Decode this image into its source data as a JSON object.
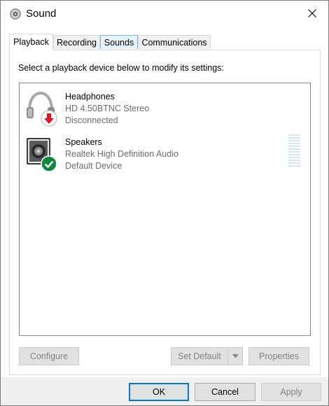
{
  "window": {
    "title": "Sound",
    "close_label": "Close"
  },
  "tabs": [
    {
      "label": "Playback",
      "active": true
    },
    {
      "label": "Recording",
      "active": false
    },
    {
      "label": "Sounds",
      "active": false
    },
    {
      "label": "Communications",
      "active": false
    }
  ],
  "panel": {
    "instruction": "Select a playback device below to modify its settings:",
    "devices": [
      {
        "name": "Headphones",
        "description": "HD 4.50BTNC Stereo",
        "status": "Disconnected",
        "icon": "headphones-icon",
        "badge": "disconnected-arrow-badge"
      },
      {
        "name": "Speakers",
        "description": "Realtek High Definition Audio",
        "status": "Default Device",
        "icon": "speaker-icon",
        "badge": "default-check-badge"
      }
    ],
    "buttons": {
      "configure": "Configure",
      "set_default": "Set Default",
      "properties": "Properties"
    }
  },
  "footer": {
    "ok": "OK",
    "cancel": "Cancel",
    "apply": "Apply"
  },
  "colors": {
    "accent": "#0078d7",
    "disabled_text": "#838383",
    "badge_red": "#e81123",
    "badge_green": "#10893e"
  }
}
